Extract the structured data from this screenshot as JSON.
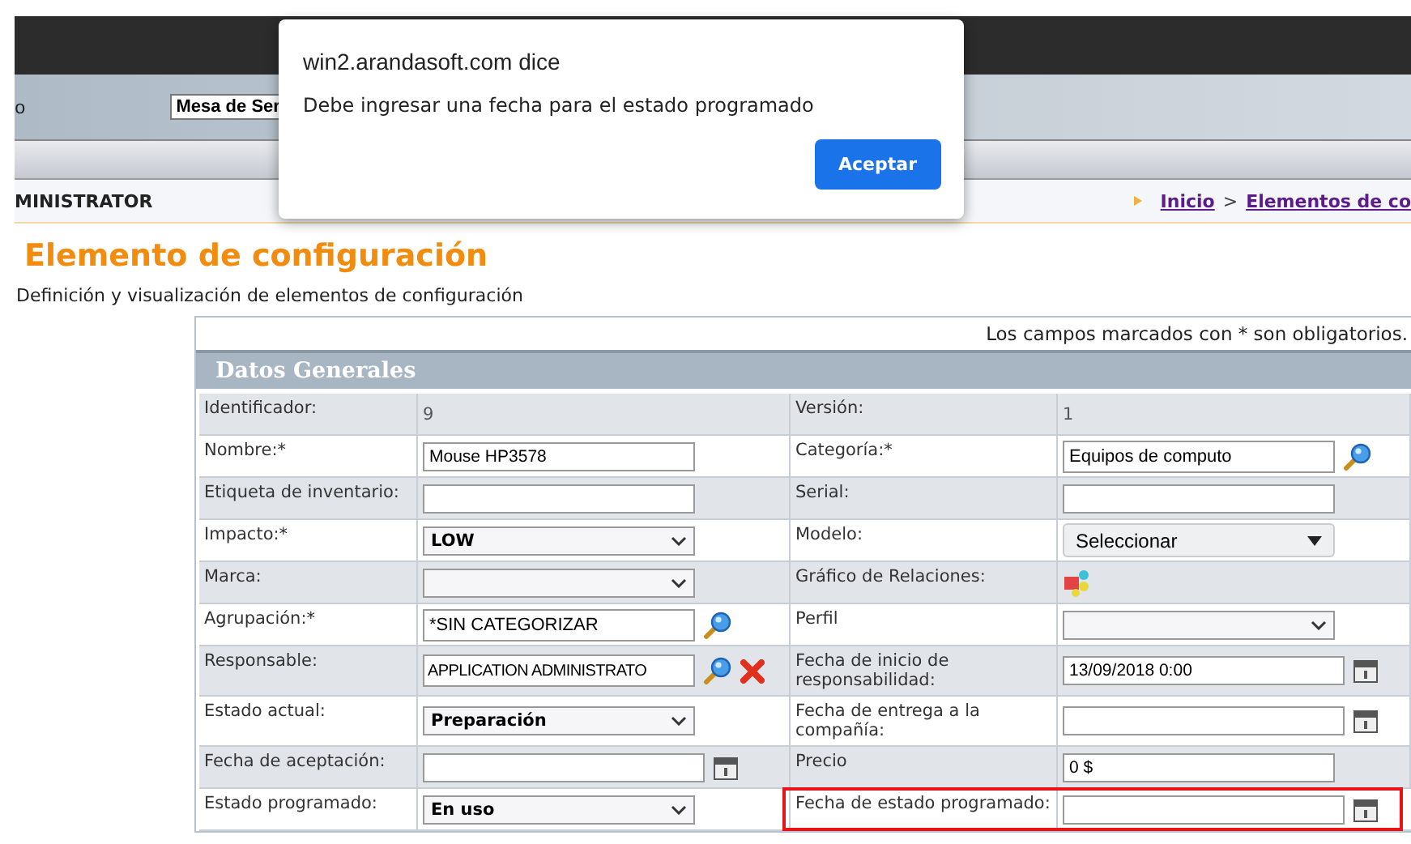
{
  "top_bar": {
    "left_text": "o",
    "select_value": "Mesa de Ser"
  },
  "breadcrumb_bar": {
    "user": "MINISTRATOR",
    "links": [
      {
        "label": "Inicio"
      },
      {
        "label": "Elementos de co"
      }
    ],
    "separator": ">"
  },
  "page": {
    "title": "Elemento de configuración",
    "subtitle": "Definición y visualización de elementos de configuración"
  },
  "form": {
    "note": "Los campos marcados con * son obligatorios.",
    "section_title": "Datos Generales",
    "rows": [
      {
        "left": {
          "label": "Identificador:",
          "kind": "static",
          "value": "9"
        },
        "right": {
          "label": "Versión:",
          "kind": "static",
          "value": "1"
        }
      },
      {
        "left": {
          "label": "Nombre:*",
          "kind": "input",
          "value": "Mouse HP3578"
        },
        "right": {
          "label": "Categoría:*",
          "kind": "input-search",
          "value": "Equipos de computo"
        }
      },
      {
        "left": {
          "label": "Etiqueta de inventario:",
          "kind": "input"
        },
        "right": {
          "label": "Serial:",
          "kind": "input"
        }
      },
      {
        "left": {
          "label": "Impacto:*",
          "kind": "select",
          "value": "LOW"
        },
        "right": {
          "label": "Modelo:",
          "kind": "dropdown",
          "value": "Seleccionar"
        }
      },
      {
        "left": {
          "label": "Marca:",
          "kind": "select"
        },
        "right": {
          "label": "Gráfico de Relaciones:",
          "kind": "relations"
        }
      },
      {
        "left": {
          "label": "Agrupación:*",
          "kind": "input-search",
          "value": "*SIN CATEGORIZAR"
        },
        "right": {
          "label": "Perfil",
          "kind": "select"
        }
      },
      {
        "left": {
          "label": "Responsable:",
          "kind": "input-search-clear",
          "value": "APPLICATION ADMINISTRATO"
        },
        "right": {
          "label": "Fecha de inicio de responsabilidad:",
          "kind": "date",
          "value": "13/09/2018 0:00"
        }
      },
      {
        "left": {
          "label": "Estado actual:",
          "kind": "select",
          "value": "Preparación"
        },
        "right": {
          "label": "Fecha de entrega a la compañía:",
          "kind": "date"
        }
      },
      {
        "left": {
          "label": "Fecha de aceptación:",
          "kind": "date"
        },
        "right": {
          "label": "Precio",
          "kind": "input",
          "value": "0 $"
        }
      },
      {
        "left": {
          "label": "Estado programado:",
          "kind": "select",
          "value": "En uso"
        },
        "right": {
          "label": "Fecha de estado programado:",
          "kind": "date",
          "highlighted": true
        }
      }
    ]
  },
  "dialog": {
    "title": "win2.arandasoft.com dice",
    "message": "Debe ingresar una fecha para el estado programado",
    "buttons": [
      {
        "label": "Aceptar"
      }
    ]
  }
}
